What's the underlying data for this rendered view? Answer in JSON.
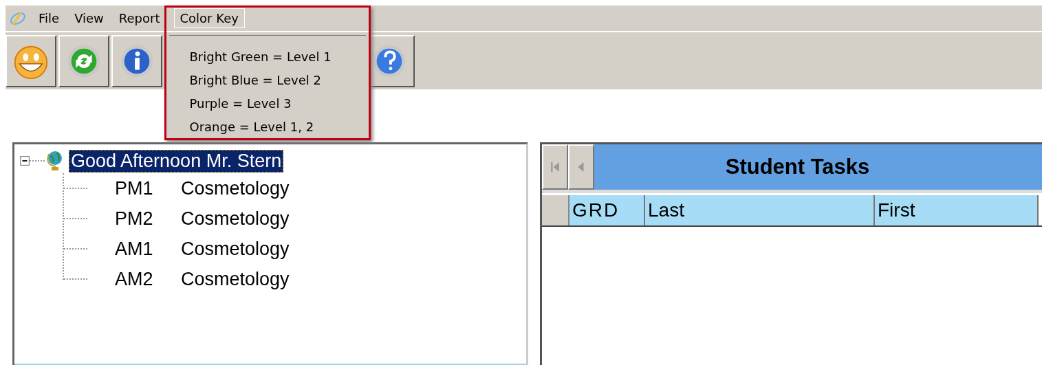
{
  "menu": [
    {
      "label": "File",
      "selected": false
    },
    {
      "label": "View",
      "selected": false
    },
    {
      "label": "Report",
      "selected": false
    },
    {
      "label": "Color Key",
      "selected": true
    }
  ],
  "color_key_menu": [
    "Bright Green = Level 1",
    "Bright Blue = Level 2",
    "Purple = Level 3",
    "Orange = Level 1, 2"
  ],
  "tree": {
    "label": "Good Afternoon Mr. Stern",
    "selected": true,
    "expanded": true,
    "children": [
      {
        "code": "PM1",
        "name": "Cosmetology"
      },
      {
        "code": "PM2",
        "name": "Cosmetology"
      },
      {
        "code": "AM1",
        "name": "Cosmetology"
      },
      {
        "code": "AM2",
        "name": "Cosmetology"
      }
    ]
  },
  "grid": {
    "title": "Student Tasks",
    "columns": [
      "GRD",
      "Last",
      "First"
    ]
  }
}
